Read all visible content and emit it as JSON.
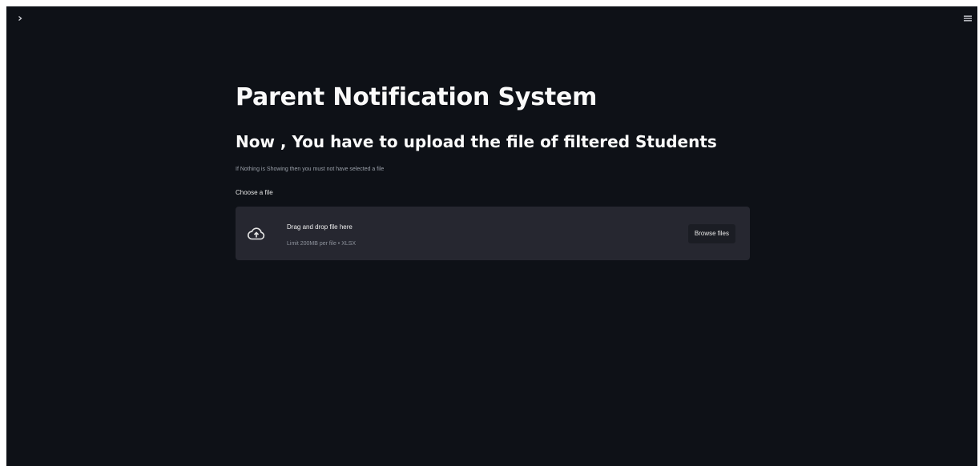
{
  "header": {
    "sidebar_toggle_icon": "chevron-right-icon",
    "menu_icon": "hamburger-menu-icon"
  },
  "main": {
    "title": "Parent Notification System",
    "subtitle": "Now , You have to upload the file of filtered Students",
    "note": "If Nothing is Showing then you must not have selected a file",
    "uploader": {
      "label": "Choose a file",
      "drop_text": "Drag and drop file here",
      "limit_text": "Limit 200MB per file • XLSX",
      "browse_label": "Browse files",
      "icon": "cloud-upload-icon"
    }
  },
  "colors": {
    "background": "#0e1117",
    "dropzone": "#262730",
    "text": "#fafafa"
  }
}
